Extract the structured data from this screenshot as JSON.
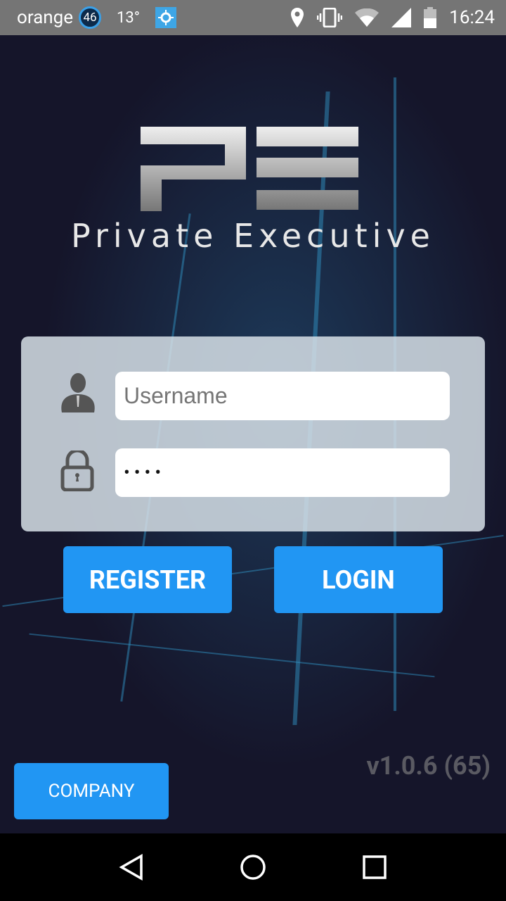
{
  "status_bar": {
    "carrier": "orange",
    "notification_count": "46",
    "temperature": "13°",
    "time": "16:24"
  },
  "logo": {
    "mark": "PE",
    "text": "Private Executive"
  },
  "form": {
    "username_placeholder": "Username",
    "password_value": "••••"
  },
  "buttons": {
    "register": "REGISTER",
    "login": "LOGIN",
    "company": "COMPANY"
  },
  "version": "v1.0.6 (65)",
  "colors": {
    "accent": "#2196f3",
    "background": "#15152a"
  }
}
